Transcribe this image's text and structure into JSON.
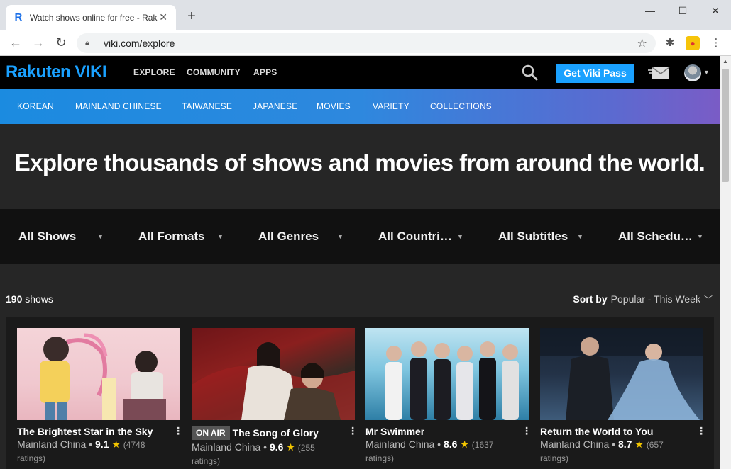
{
  "browser": {
    "tab_title": "Watch shows online for free - Rakuten Viki",
    "tab_favicon": "R",
    "url": "viki.com/explore",
    "icons": [
      "back-icon",
      "forward-icon",
      "reload-icon",
      "lock-icon",
      "star-icon",
      "puzzle-icon",
      "profile-extension-icon",
      "menu-icon"
    ]
  },
  "header": {
    "logo": "Rakuten VIKI",
    "nav": [
      "EXPLORE",
      "COMMUNITY",
      "APPS"
    ],
    "viki_pass": "Get Viki Pass",
    "brand_color": "#1aa1ff"
  },
  "categories": [
    "KOREAN",
    "MAINLAND CHINESE",
    "TAIWANESE",
    "JAPANESE",
    "MOVIES",
    "VARIETY",
    "COLLECTIONS"
  ],
  "hero": {
    "title": "Explore thousands of shows and movies from around the world."
  },
  "filters": [
    "All Shows",
    "All Formats",
    "All Genres",
    "All Countri…",
    "All Subtitles",
    "All Schedu…"
  ],
  "results": {
    "count_number": "190",
    "count_label": "shows",
    "sort_label": "Sort by",
    "sort_value": "Popular - This Week"
  },
  "shows": [
    {
      "title": "The Brightest Star in the Sky",
      "country": "Mainland China",
      "rating": "9.1",
      "ratings_count": "(4748",
      "ratings_word": "ratings)",
      "on_air": ""
    },
    {
      "title": "The Song of Glory",
      "country": "Mainland China",
      "rating": "9.6",
      "ratings_count": "(255",
      "ratings_word": "ratings)",
      "on_air": "ON AIR"
    },
    {
      "title": "Mr Swimmer",
      "country": "Mainland China",
      "rating": "8.6",
      "ratings_count": "(1637",
      "ratings_word": "ratings)",
      "on_air": ""
    },
    {
      "title": "Return the World to You",
      "country": "Mainland China",
      "rating": "8.7",
      "ratings_count": "(657",
      "ratings_word": "ratings)",
      "on_air": ""
    }
  ]
}
